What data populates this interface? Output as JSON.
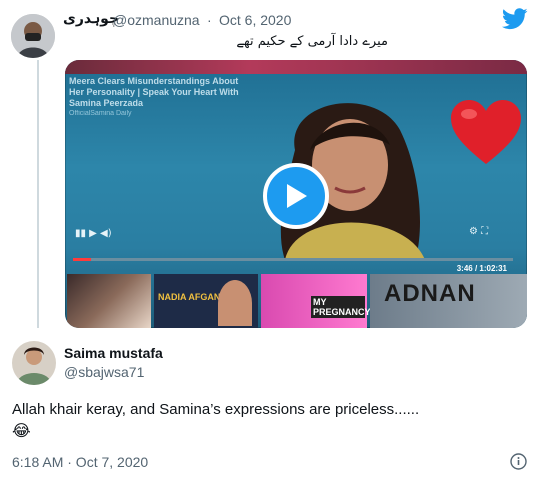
{
  "tweet1": {
    "display_name": "چوہدری",
    "handle": "@ozmanuzna",
    "separator": "·",
    "date": "Oct 6, 2020",
    "text": "میرے دادا آرمی کے حکیم تھے"
  },
  "video": {
    "title": "Meera Clears Misunderstandings About Her Personality | Speak Your Heart With Samina Peerzada",
    "subtitle": "OfficialSamina Daily",
    "time": "3:46 / 1:02:31",
    "progress_fraction": 0.04,
    "thumb_labels": [
      "NADIA AFGAN",
      "MY PREGNANCY",
      "ADNAN"
    ]
  },
  "tweet2": {
    "display_name": "Saima mustafa",
    "handle": "@sbajwsa71",
    "text": "Allah khair keray, and Samina’s expressions are priceless......",
    "emoji": "😂",
    "timestamp": "6:18 AM · Oct 7, 2020"
  },
  "icons": {
    "twitter": "twitter-bird-icon",
    "play": "play-icon",
    "heart": "red-heart-icon",
    "info": "info-icon"
  },
  "colors": {
    "accent": "#1d9bf0",
    "heart": "#e0202a",
    "muted": "#536471"
  }
}
